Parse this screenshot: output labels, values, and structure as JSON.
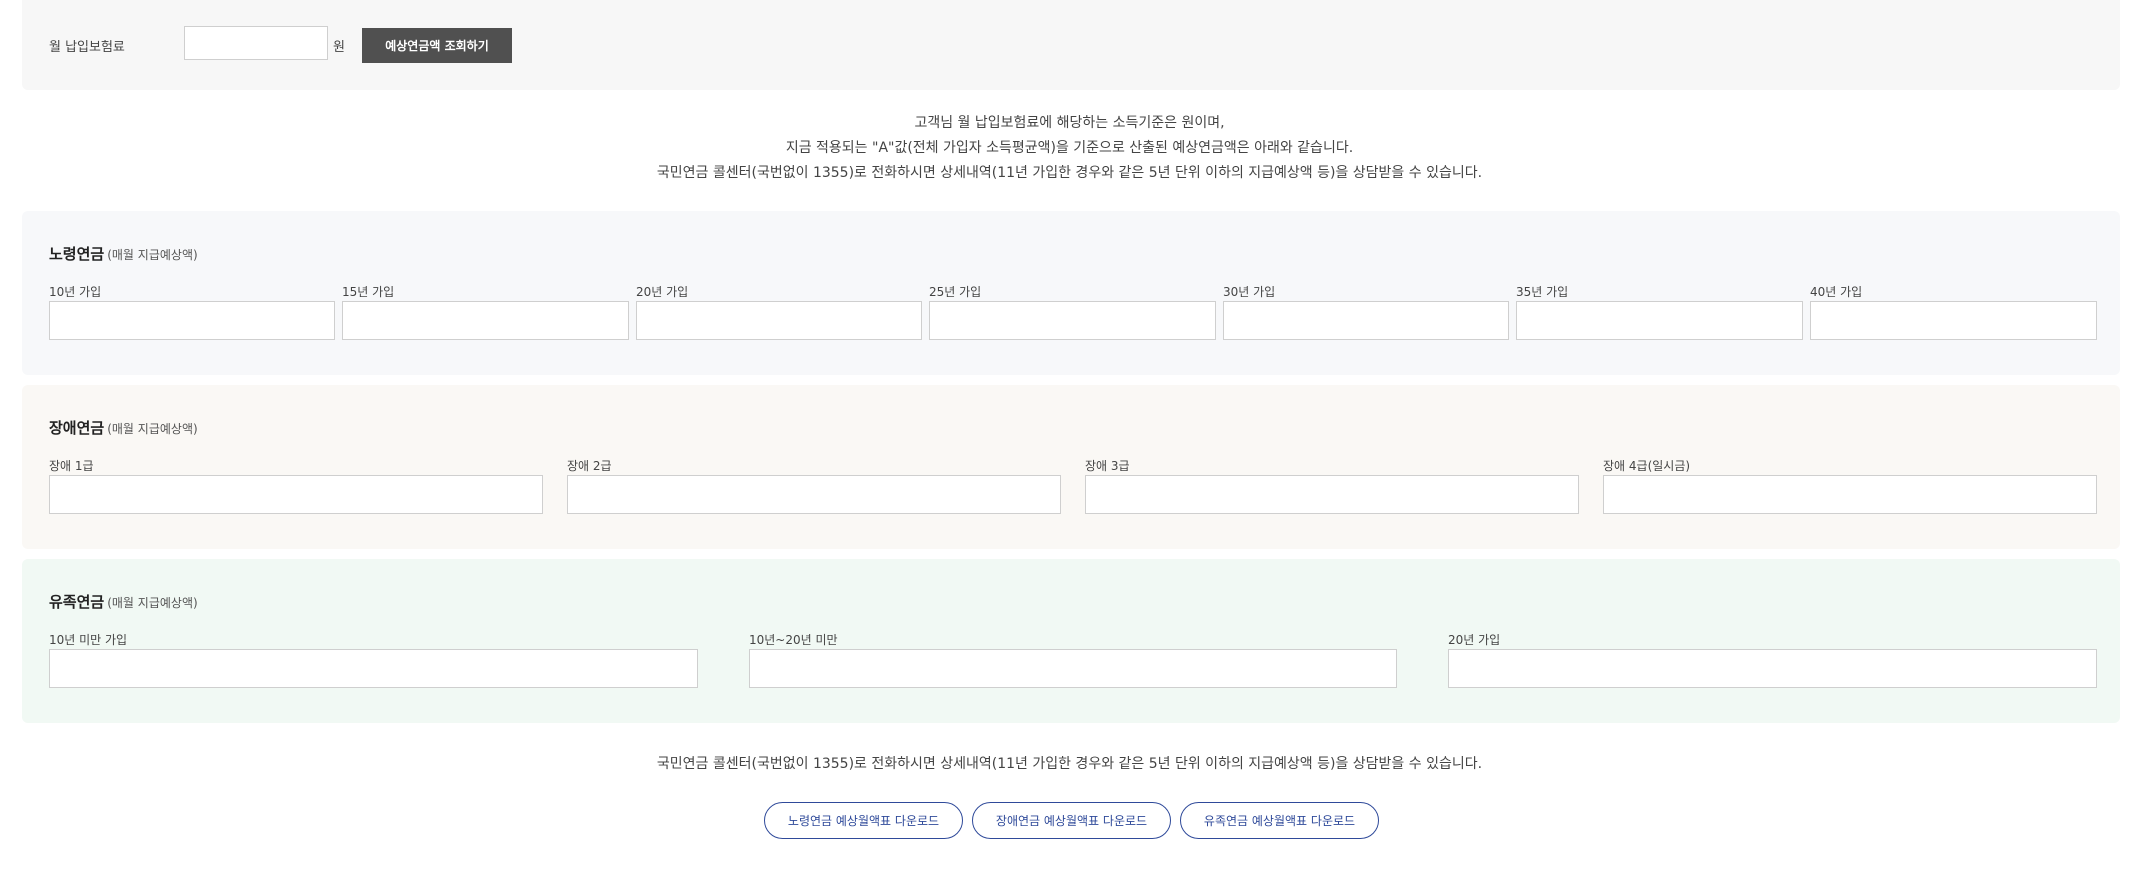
{
  "search": {
    "label": "월 납입보험료",
    "input_value": "",
    "unit": "원",
    "button": "예상연금액 조회하기"
  },
  "info_lines": [
    "고객님 월 납입보험료에 해당하는 소득기준은 원이며,",
    "지금 적용되는 \"A\"값(전체 가입자 소득평균액)을 기준으로 산출된 예상연금액은 아래와 같습니다.",
    "국민연금 콜센터(국번없이 1355)로 전화하시면 상세내역(11년 가입한 경우와 같은 5년 단위 이하의 지급예상액 등)을 상담받을 수 있습니다."
  ],
  "old_age": {
    "title": "노령연금",
    "subtitle": "(매월 지급예상액)",
    "fields": [
      {
        "label": "10년 가입",
        "value": ""
      },
      {
        "label": "15년 가입",
        "value": ""
      },
      {
        "label": "20년 가입",
        "value": ""
      },
      {
        "label": "25년 가입",
        "value": ""
      },
      {
        "label": "30년 가입",
        "value": ""
      },
      {
        "label": "35년 가입",
        "value": ""
      },
      {
        "label": "40년 가입",
        "value": ""
      }
    ]
  },
  "disability": {
    "title": "장애연금",
    "subtitle": "(매월 지급예상액)",
    "fields": [
      {
        "label": "장애 1급",
        "value": ""
      },
      {
        "label": "장애 2급",
        "value": ""
      },
      {
        "label": "장애 3급",
        "value": ""
      },
      {
        "label": "장애 4급(일시금)",
        "value": ""
      }
    ]
  },
  "survivor": {
    "title": "유족연금",
    "subtitle": "(매월 지급예상액)",
    "fields": [
      {
        "label": "10년 미만 가입",
        "value": ""
      },
      {
        "label": "10년~20년 미만",
        "value": ""
      },
      {
        "label": "20년 가입",
        "value": ""
      }
    ]
  },
  "bottom_note": "국민연금 콜센터(국번없이 1355)로 전화하시면 상세내역(11년 가입한 경우와 같은 5년 단위 이하의 지급예상액 등)을 상담받을 수 있습니다.",
  "downloads": [
    "노령연금 예상월액표 다운로드",
    "장애연금 예상월액표 다운로드",
    "유족연금 예상월액표 다운로드"
  ],
  "colors": {
    "button_dark": "#505050",
    "download_accent": "#2f4a9a",
    "old_age_bg": "#f7f8fa",
    "disability_bg": "#faf8f5",
    "survivor_bg": "#f1f9f4"
  }
}
